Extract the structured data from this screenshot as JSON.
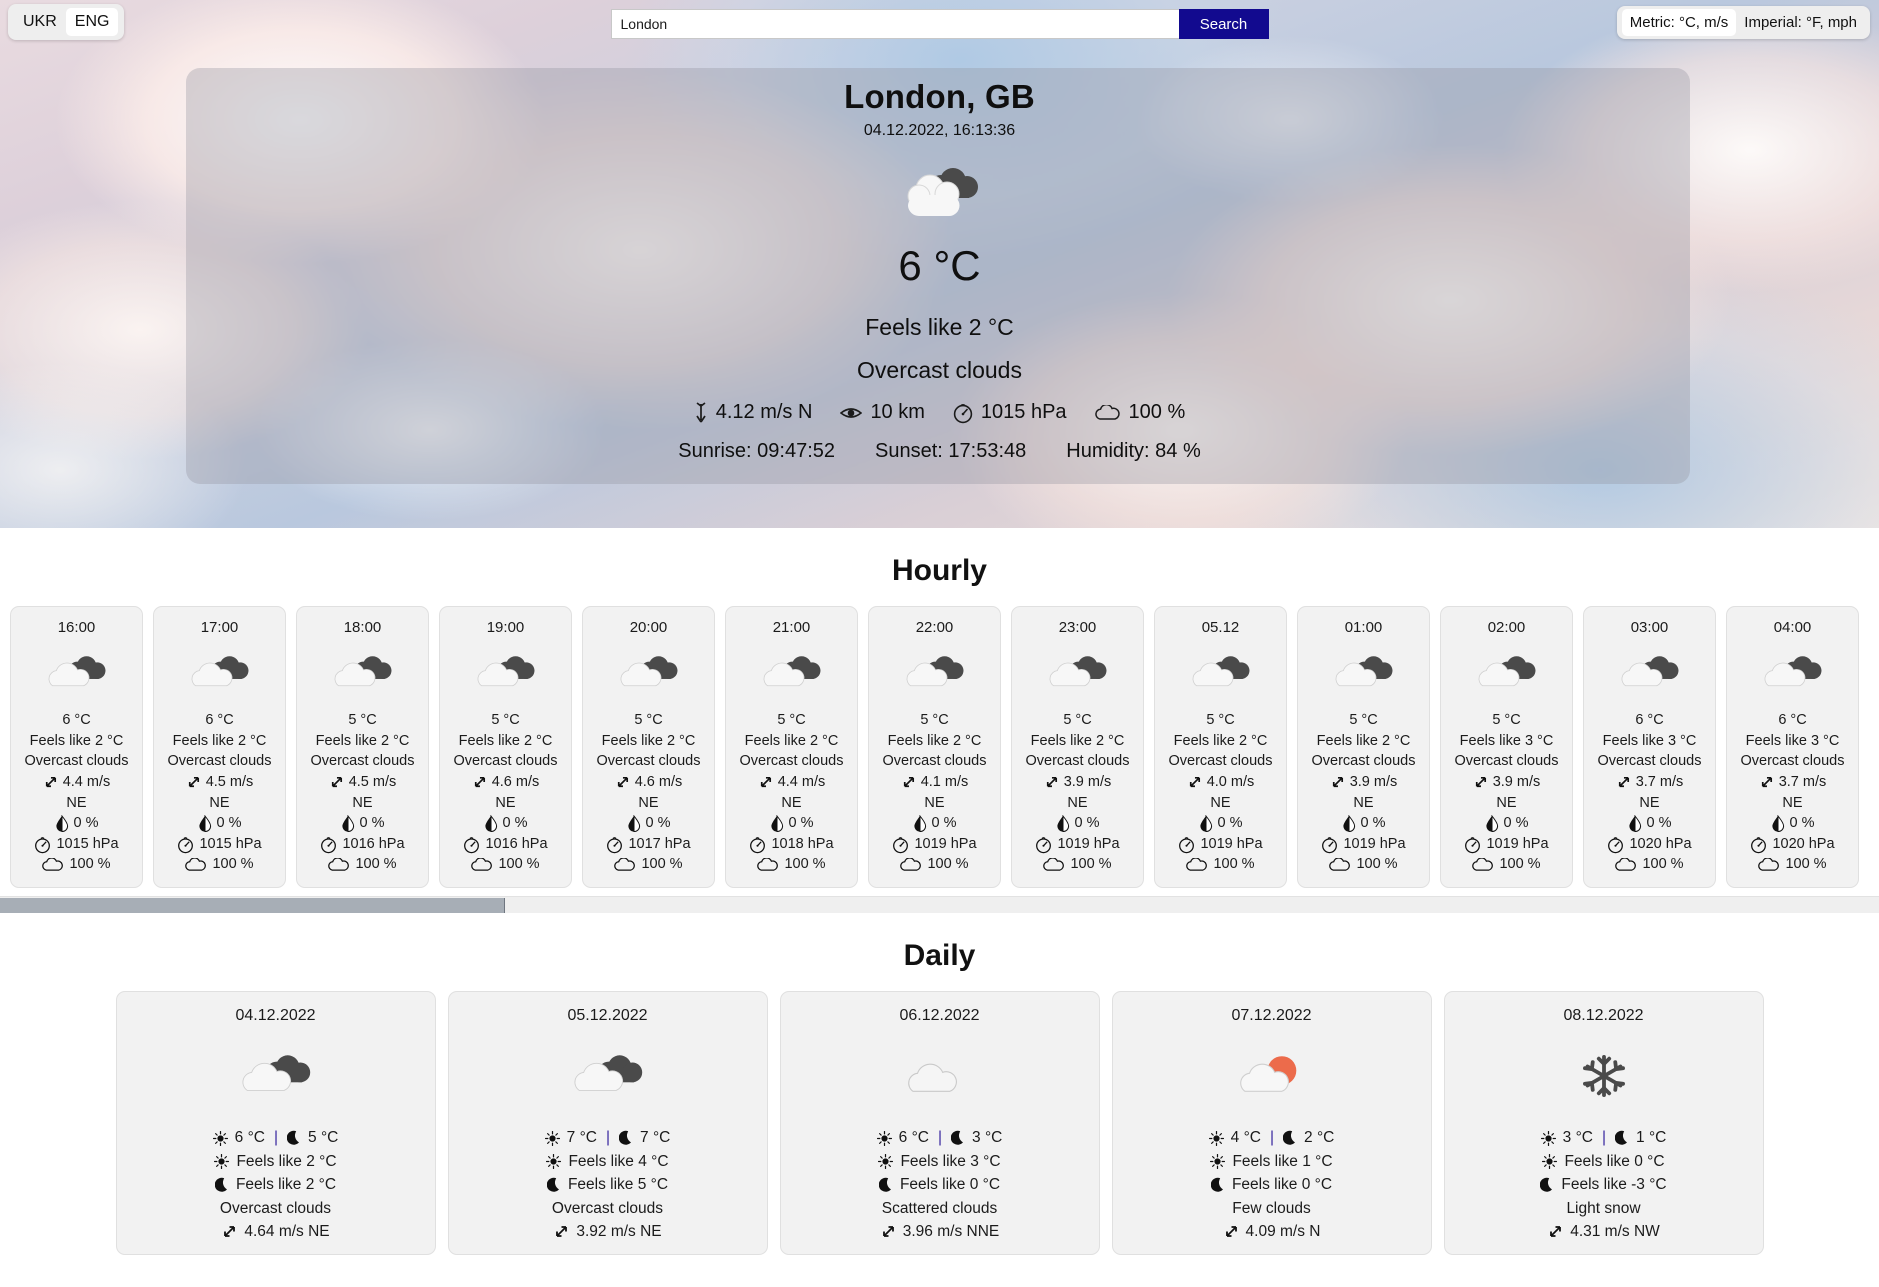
{
  "topbar": {
    "lang": {
      "options": [
        "UKR",
        "ENG"
      ],
      "active": "ENG"
    },
    "search": {
      "value": "London",
      "placeholder": "City",
      "button_label": "Search"
    },
    "units": {
      "metric_label": "Metric: °C, m/s",
      "imperial_label": "Imperial: °F, mph",
      "active": "Metric: °C, m/s"
    }
  },
  "current": {
    "city": "London, GB",
    "datetime": "04.12.2022, 16:13:36",
    "icon": "overcast-clouds-icon",
    "temp": "6 °C",
    "feels_like": "Feels like 2 °C",
    "description": "Overcast clouds",
    "wind": "4.12 m/s N",
    "visibility": "10 km",
    "pressure": "1015 hPa",
    "clouds": "100 %",
    "sunrise": "Sunrise: 09:47:52",
    "sunset": "Sunset: 17:53:48",
    "humidity": "Humidity: 84 %"
  },
  "hourly": {
    "title": "Hourly",
    "items": [
      {
        "time": "16:00",
        "icon": "overcast-clouds-icon",
        "temp": "6 °C",
        "feels": "Feels like 2 °C",
        "desc": "Overcast clouds",
        "wind": "4.4 m/s",
        "dir": "NE",
        "pop": "0 %",
        "pressure": "1015 hPa",
        "clouds": "100 %"
      },
      {
        "time": "17:00",
        "icon": "overcast-clouds-icon",
        "temp": "6 °C",
        "feels": "Feels like 2 °C",
        "desc": "Overcast clouds",
        "wind": "4.5 m/s",
        "dir": "NE",
        "pop": "0 %",
        "pressure": "1015 hPa",
        "clouds": "100 %"
      },
      {
        "time": "18:00",
        "icon": "overcast-clouds-icon",
        "temp": "5 °C",
        "feels": "Feels like 2 °C",
        "desc": "Overcast clouds",
        "wind": "4.5 m/s",
        "dir": "NE",
        "pop": "0 %",
        "pressure": "1016 hPa",
        "clouds": "100 %"
      },
      {
        "time": "19:00",
        "icon": "overcast-clouds-icon",
        "temp": "5 °C",
        "feels": "Feels like 2 °C",
        "desc": "Overcast clouds",
        "wind": "4.6 m/s",
        "dir": "NE",
        "pop": "0 %",
        "pressure": "1016 hPa",
        "clouds": "100 %"
      },
      {
        "time": "20:00",
        "icon": "overcast-clouds-icon",
        "temp": "5 °C",
        "feels": "Feels like 2 °C",
        "desc": "Overcast clouds",
        "wind": "4.6 m/s",
        "dir": "NE",
        "pop": "0 %",
        "pressure": "1017 hPa",
        "clouds": "100 %"
      },
      {
        "time": "21:00",
        "icon": "overcast-clouds-icon",
        "temp": "5 °C",
        "feels": "Feels like 2 °C",
        "desc": "Overcast clouds",
        "wind": "4.4 m/s",
        "dir": "NE",
        "pop": "0 %",
        "pressure": "1018 hPa",
        "clouds": "100 %"
      },
      {
        "time": "22:00",
        "icon": "overcast-clouds-icon",
        "temp": "5 °C",
        "feels": "Feels like 2 °C",
        "desc": "Overcast clouds",
        "wind": "4.1 m/s",
        "dir": "NE",
        "pop": "0 %",
        "pressure": "1019 hPa",
        "clouds": "100 %"
      },
      {
        "time": "23:00",
        "icon": "overcast-clouds-icon",
        "temp": "5 °C",
        "feels": "Feels like 2 °C",
        "desc": "Overcast clouds",
        "wind": "3.9 m/s",
        "dir": "NE",
        "pop": "0 %",
        "pressure": "1019 hPa",
        "clouds": "100 %"
      },
      {
        "time": "05.12",
        "icon": "overcast-clouds-icon",
        "temp": "5 °C",
        "feels": "Feels like 2 °C",
        "desc": "Overcast clouds",
        "wind": "4.0 m/s",
        "dir": "NE",
        "pop": "0 %",
        "pressure": "1019 hPa",
        "clouds": "100 %"
      },
      {
        "time": "01:00",
        "icon": "overcast-clouds-icon",
        "temp": "5 °C",
        "feels": "Feels like 2 °C",
        "desc": "Overcast clouds",
        "wind": "3.9 m/s",
        "dir": "NE",
        "pop": "0 %",
        "pressure": "1019 hPa",
        "clouds": "100 %"
      },
      {
        "time": "02:00",
        "icon": "overcast-clouds-icon",
        "temp": "5 °C",
        "feels": "Feels like 3 °C",
        "desc": "Overcast clouds",
        "wind": "3.9 m/s",
        "dir": "NE",
        "pop": "0 %",
        "pressure": "1019 hPa",
        "clouds": "100 %"
      },
      {
        "time": "03:00",
        "icon": "overcast-clouds-icon",
        "temp": "6 °C",
        "feels": "Feels like 3 °C",
        "desc": "Overcast clouds",
        "wind": "3.7 m/s",
        "dir": "NE",
        "pop": "0 %",
        "pressure": "1020 hPa",
        "clouds": "100 %"
      },
      {
        "time": "04:00",
        "icon": "overcast-clouds-icon",
        "temp": "6 °C",
        "feels": "Feels like 3 °C",
        "desc": "Overcast clouds",
        "wind": "3.7 m/s",
        "dir": "NE",
        "pop": "0 %",
        "pressure": "1020 hPa",
        "clouds": "100 %"
      }
    ]
  },
  "daily": {
    "title": "Daily",
    "items": [
      {
        "date": "04.12.2022",
        "icon": "overcast-clouds-icon",
        "day_temp": "6 °C",
        "night_temp": "5 °C",
        "day_feels": "Feels like 2 °C",
        "night_feels": "Feels like 2 °C",
        "desc": "Overcast clouds",
        "wind": "4.64 m/s NE"
      },
      {
        "date": "05.12.2022",
        "icon": "overcast-clouds-icon",
        "day_temp": "7 °C",
        "night_temp": "7 °C",
        "day_feels": "Feels like 4 °C",
        "night_feels": "Feels like 5 °C",
        "desc": "Overcast clouds",
        "wind": "3.92 m/s NE"
      },
      {
        "date": "06.12.2022",
        "icon": "scattered-clouds-icon",
        "day_temp": "6 °C",
        "night_temp": "3 °C",
        "day_feels": "Feels like 3 °C",
        "night_feels": "Feels like 0 °C",
        "desc": "Scattered clouds",
        "wind": "3.96 m/s NNE"
      },
      {
        "date": "07.12.2022",
        "icon": "few-clouds-icon",
        "day_temp": "4 °C",
        "night_temp": "2 °C",
        "day_feels": "Feels like 1 °C",
        "night_feels": "Feels like 0 °C",
        "desc": "Few clouds",
        "wind": "4.09 m/s N"
      },
      {
        "date": "08.12.2022",
        "icon": "light-snow-icon",
        "day_temp": "3 °C",
        "night_temp": "1 °C",
        "day_feels": "Feels like 0 °C",
        "night_feels": "Feels like -3 °C",
        "desc": "Light snow",
        "wind": "4.31 m/s NW"
      }
    ]
  },
  "colors": {
    "search_button": "#120a8f",
    "card_bg": "#f2f2f2",
    "cloud_dark": "#4a4a4a",
    "cloud_light": "#f7f7f7",
    "sun": "#ec6b4b"
  },
  "separator": "|"
}
